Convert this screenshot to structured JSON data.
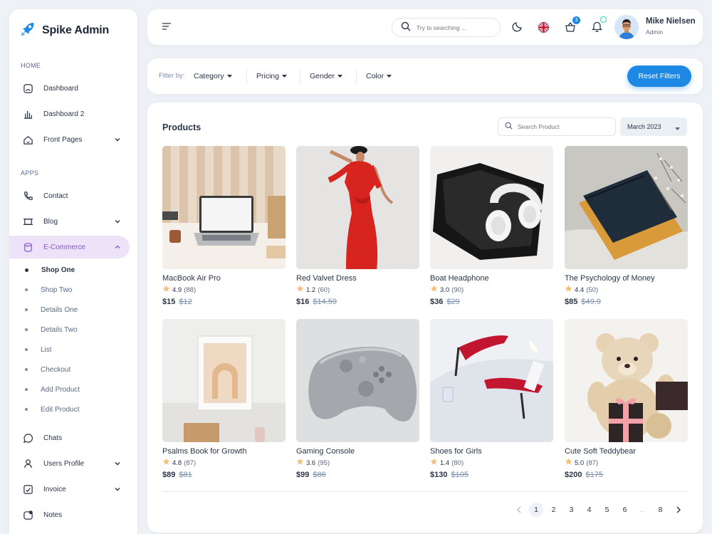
{
  "brand": {
    "name": "Spike Admin"
  },
  "sidebar": {
    "caption_home": "HOME",
    "caption_apps": "APPS",
    "home_items": [
      {
        "label": "Dashboard"
      },
      {
        "label": "Dashboard 2"
      },
      {
        "label": "Front Pages"
      }
    ],
    "app_items": [
      {
        "label": "Contact"
      },
      {
        "label": "Blog"
      },
      {
        "label": "E-Commerce"
      }
    ],
    "ecommerce_sub": [
      {
        "label": "Shop One"
      },
      {
        "label": "Shop Two"
      },
      {
        "label": "Details One"
      },
      {
        "label": "Details Two"
      },
      {
        "label": "List"
      },
      {
        "label": "Checkout"
      },
      {
        "label": "Add Product"
      },
      {
        "label": "Edit Product"
      }
    ],
    "bottom_items": [
      {
        "label": "Chats"
      },
      {
        "label": "Users Profile"
      },
      {
        "label": "Invoice"
      },
      {
        "label": "Notes"
      }
    ]
  },
  "header": {
    "search_placeholder": "Try to searching ...",
    "cart_count": "3",
    "user_name": "Mike Nielsen",
    "user_role": "Admin"
  },
  "filters": {
    "label": "Filter by:",
    "options": [
      "Category",
      "Pricing",
      "Gender",
      "Color"
    ],
    "reset_label": "Reset Filters"
  },
  "products_panel": {
    "title": "Products",
    "search_placeholder": "Search Product",
    "month": "March 2023",
    "items": [
      {
        "name": "MacBook Air Pro",
        "rating": "4.9",
        "count": "(88)",
        "price": "$15",
        "old_price": "$12"
      },
      {
        "name": "Red Valvet Dress",
        "rating": "1.2",
        "count": "(60)",
        "price": "$16",
        "old_price": "$14.59"
      },
      {
        "name": "Boat Headphone",
        "rating": "3.0",
        "count": "(90)",
        "price": "$36",
        "old_price": "$29"
      },
      {
        "name": "The Psychology of Money",
        "rating": "4.4",
        "count": "(50)",
        "price": "$85",
        "old_price": "$49.9"
      },
      {
        "name": "Psalms Book for Growth",
        "rating": "4.8",
        "count": "(87)",
        "price": "$89",
        "old_price": "$81"
      },
      {
        "name": "Gaming Console",
        "rating": "3.6",
        "count": "(95)",
        "price": "$99",
        "old_price": "$86"
      },
      {
        "name": "Shoes for Girls",
        "rating": "1.4",
        "count": "(80)",
        "price": "$130",
        "old_price": "$105"
      },
      {
        "name": "Cute Soft Teddybear",
        "rating": "5.0",
        "count": "(87)",
        "price": "$200",
        "old_price": "$175"
      }
    ]
  },
  "pagination": {
    "pages": [
      "1",
      "2",
      "3",
      "4",
      "5",
      "6",
      "...",
      "8"
    ],
    "active": "1"
  },
  "colors": {
    "primary": "#1e88e5",
    "active_nav_bg": "#ece3f8",
    "active_nav_text": "#8a56c9",
    "star": "#f8c076"
  }
}
